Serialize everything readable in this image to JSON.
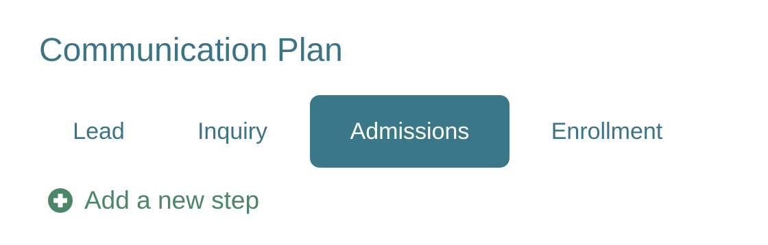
{
  "page": {
    "title": "Communication Plan"
  },
  "tabs": [
    {
      "label": "Lead",
      "active": false
    },
    {
      "label": "Inquiry",
      "active": false
    },
    {
      "label": "Admissions",
      "active": true
    },
    {
      "label": "Enrollment",
      "active": false
    }
  ],
  "add_step": {
    "label": "Add a new step",
    "icon": "plus-circle-icon"
  },
  "colors": {
    "title": "#3b7487",
    "tab_text": "#3b7487",
    "active_tab_bg": "#3a7889",
    "active_tab_text": "#ffffff",
    "add_step": "#4b8668"
  }
}
